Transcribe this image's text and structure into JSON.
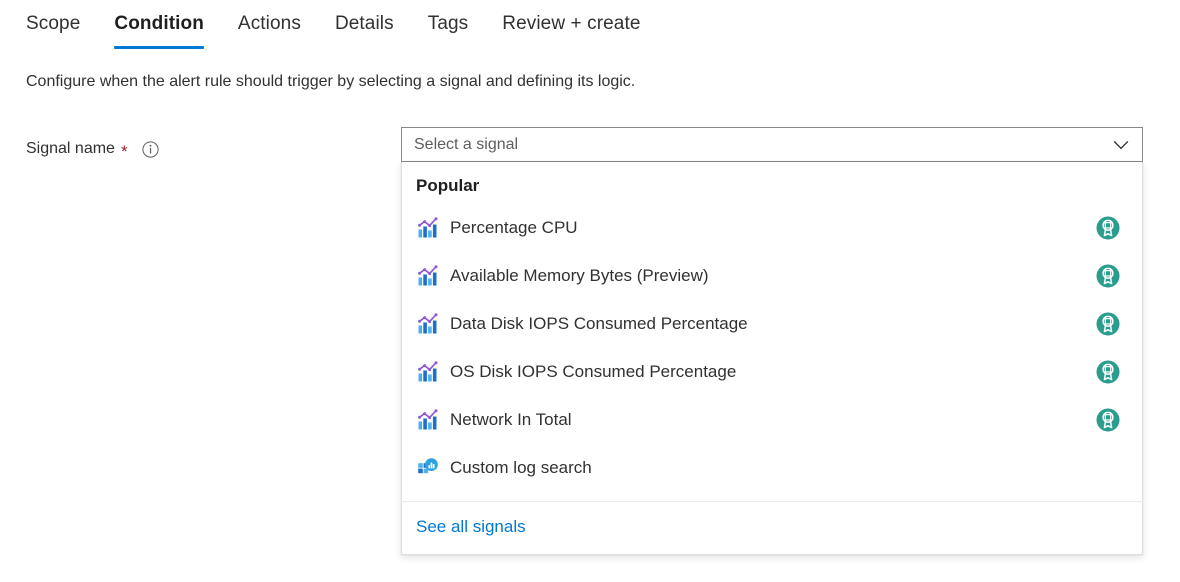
{
  "tabs": [
    {
      "label": "Scope",
      "selected": false
    },
    {
      "label": "Condition",
      "selected": true
    },
    {
      "label": "Actions",
      "selected": false
    },
    {
      "label": "Details",
      "selected": false
    },
    {
      "label": "Tags",
      "selected": false
    },
    {
      "label": "Review + create",
      "selected": false
    }
  ],
  "description": "Configure when the alert rule should trigger by selecting a signal and defining its logic.",
  "field": {
    "label": "Signal name",
    "required_marker": "*",
    "info_icon": "info-circle-icon"
  },
  "combobox": {
    "placeholder": "Select a signal",
    "value": "",
    "chevron_icon": "chevron-down-icon"
  },
  "dropdown": {
    "group_header": "Popular",
    "items": [
      {
        "label": "Percentage CPU",
        "icon": "metric-chart-icon",
        "badge": "popular-award-badge-icon"
      },
      {
        "label": "Available Memory Bytes (Preview)",
        "icon": "metric-chart-icon",
        "badge": "popular-award-badge-icon"
      },
      {
        "label": "Data Disk IOPS Consumed Percentage",
        "icon": "metric-chart-icon",
        "badge": "popular-award-badge-icon"
      },
      {
        "label": "OS Disk IOPS Consumed Percentage",
        "icon": "metric-chart-icon",
        "badge": "popular-award-badge-icon"
      },
      {
        "label": "Network In Total",
        "icon": "metric-chart-icon",
        "badge": "popular-award-badge-icon"
      },
      {
        "label": "Custom log search",
        "icon": "log-analytics-icon",
        "badge": ""
      }
    ],
    "footer_link": "See all signals"
  },
  "colors": {
    "accent": "#0078d4",
    "link": "#0078d4",
    "required": "#a4262c",
    "badge": "#2a9d8f",
    "text": "#323130"
  }
}
